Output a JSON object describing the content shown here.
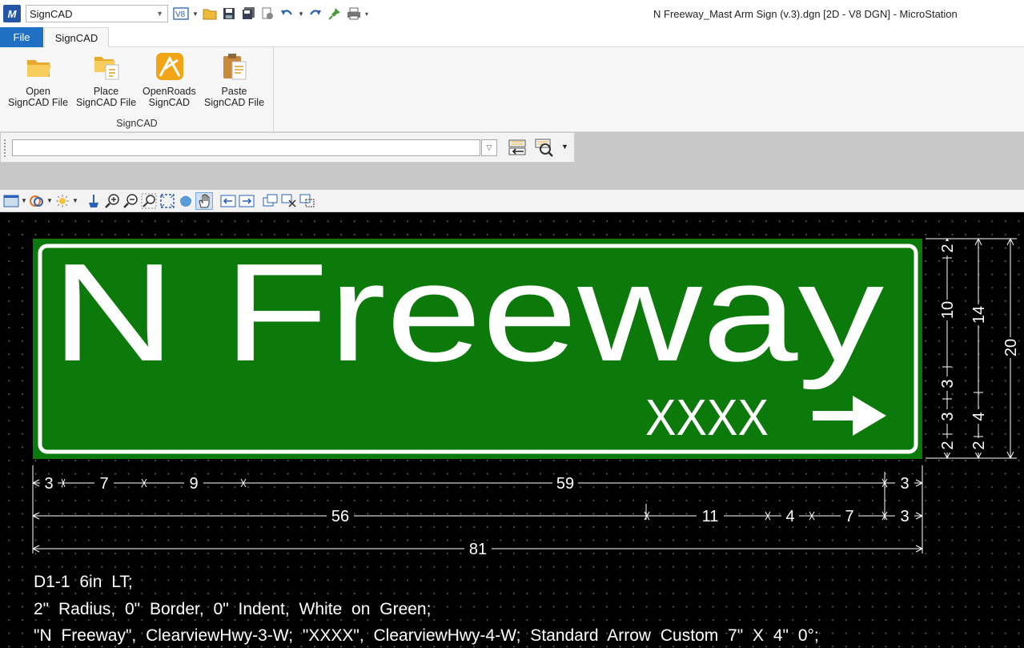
{
  "titlebar": {
    "workflow": "SignCAD",
    "qat_v8_label": "V8",
    "window_title": "N Freeway_Mast Arm Sign (v.3).dgn [2D - V8 DGN] - MicroStation"
  },
  "ribbon": {
    "tabs": [
      "File",
      "SignCAD"
    ],
    "group_label": "SignCAD",
    "buttons": [
      {
        "line1": "Open",
        "line2": "SignCAD File",
        "icon": "folder-open-icon"
      },
      {
        "line1": "Place",
        "line2": "SignCAD File",
        "icon": "folder-place-icon"
      },
      {
        "line1": "OpenRoads",
        "line2": "SignCAD",
        "icon": "openroads-signcad-icon"
      },
      {
        "line1": "Paste",
        "line2": "SignCAD File",
        "icon": "clipboard-paste-icon"
      }
    ]
  },
  "keyin": {
    "value": ""
  },
  "sign": {
    "title": "N Freeway",
    "subtitle": "XXXX",
    "colors": {
      "background": "#0b7a0b",
      "legend": "#ffffff",
      "canvas": "#000000"
    }
  },
  "dimensions": {
    "row1": [
      "3",
      "7",
      "9",
      "59",
      "3"
    ],
    "row2": [
      "56",
      "11",
      "4",
      "7",
      "3"
    ],
    "row3": [
      "81"
    ],
    "vertical_inner": [
      "2",
      "10",
      "3",
      "3",
      "2"
    ],
    "vertical_mid": [
      "14",
      "4",
      "2"
    ],
    "vertical_outer": [
      "20"
    ]
  },
  "annotations": [
    "D1-1 6in LT;",
    "2\" Radius, 0\" Border, 0\" Indent, White on Green;",
    "\"N Freeway\", ClearviewHwy-3-W; \"XXXX\", ClearviewHwy-4-W; Standard Arrow Custom 7\" X 4\" 0°;"
  ]
}
